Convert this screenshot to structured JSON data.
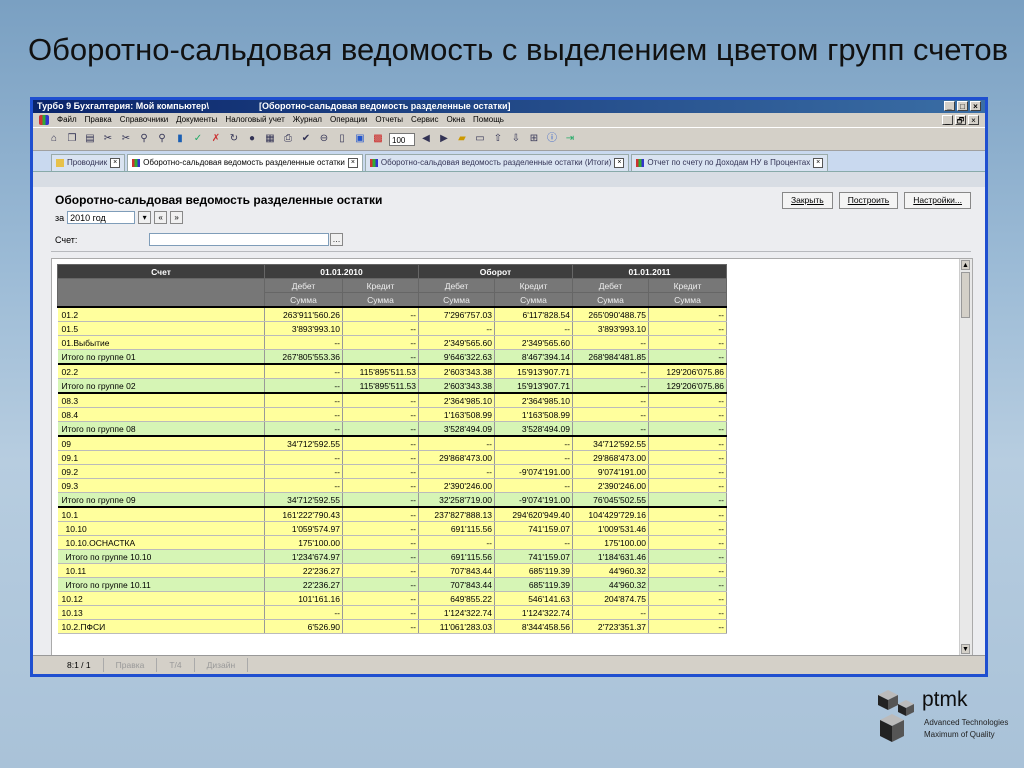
{
  "slide": {
    "title": "Оборотно-сальдовая ведомость с выделением цветом групп счетов"
  },
  "window": {
    "title_app": "Турбо 9 Бухгалтерия: Мой компьютер\\",
    "title_doc": "[Оборотно-сальдовая ведомость разделенные остатки]",
    "controls": [
      "_",
      "□",
      "×"
    ],
    "doc_controls": [
      "_",
      "🗗",
      "×"
    ]
  },
  "menu": [
    "Файл",
    "Правка",
    "Справочники",
    "Документы",
    "Налоговый учет",
    "Журнал",
    "Операции",
    "Отчеты",
    "Сервис",
    "Окна",
    "Помощь"
  ],
  "toolbar": {
    "zoom": "100"
  },
  "tabs": [
    {
      "label": "Проводник",
      "active": false
    },
    {
      "label": "Оборотно-сальдовая ведомость разделенные остатки",
      "active": true
    },
    {
      "label": "Оборотно-сальдовая ведомость разделенные остатки (Итоги)",
      "active": false
    },
    {
      "label": "Отчет по счету по Доходам НУ в Процентах",
      "active": false
    }
  ],
  "form": {
    "title": "Оборотно-сальдовая ведомость разделенные остатки",
    "buttons": {
      "close": "Закрыть",
      "build": "Построить",
      "settings": "Настройки..."
    },
    "period_label": "за",
    "period_value": "2010 год",
    "account_label": "Счет:",
    "account_value": ""
  },
  "table": {
    "group_headers": [
      "Счет",
      "01.01.2010",
      "Оборот",
      "01.01.2011"
    ],
    "sub_headers": [
      "Дебет",
      "Кредит",
      "Дебет",
      "Кредит",
      "Дебет",
      "Кредит"
    ],
    "sum_label": "Сумма",
    "rows": [
      {
        "name": "01.2",
        "style": "y",
        "bold": true,
        "indent": 0,
        "v": [
          "263'911'560.26",
          "--",
          "7'296'757.03",
          "6'117'828.54",
          "265'090'488.75",
          "--"
        ]
      },
      {
        "name": "01.5",
        "style": "y",
        "bold": false,
        "indent": 0,
        "v": [
          "3'893'993.10",
          "--",
          "--",
          "--",
          "3'893'993.10",
          "--"
        ]
      },
      {
        "name": "01.Выбытие",
        "style": "y",
        "bold": false,
        "indent": 0,
        "v": [
          "--",
          "--",
          "2'349'565.60",
          "2'349'565.60",
          "--",
          "--"
        ]
      },
      {
        "name": "Итого по группе 01",
        "style": "g",
        "bold": false,
        "indent": 0,
        "v": [
          "267'805'553.36",
          "--",
          "9'646'322.63",
          "8'467'394.14",
          "268'984'481.85",
          "--"
        ]
      },
      {
        "name": "02.2",
        "style": "y",
        "bold": true,
        "indent": 0,
        "v": [
          "--",
          "115'895'511.53",
          "2'603'343.38",
          "15'913'907.71",
          "--",
          "129'206'075.86"
        ]
      },
      {
        "name": "Итого по группе 02",
        "style": "g",
        "bold": false,
        "indent": 0,
        "v": [
          "--",
          "115'895'511.53",
          "2'603'343.38",
          "15'913'907.71",
          "--",
          "129'206'075.86"
        ]
      },
      {
        "name": "08.3",
        "style": "y",
        "bold": true,
        "indent": 0,
        "v": [
          "--",
          "--",
          "2'364'985.10",
          "2'364'985.10",
          "--",
          "--"
        ]
      },
      {
        "name": "08.4",
        "style": "y",
        "bold": false,
        "indent": 0,
        "v": [
          "--",
          "--",
          "1'163'508.99",
          "1'163'508.99",
          "--",
          "--"
        ]
      },
      {
        "name": "Итого по группе 08",
        "style": "g",
        "bold": false,
        "indent": 0,
        "v": [
          "--",
          "--",
          "3'528'494.09",
          "3'528'494.09",
          "--",
          "--"
        ]
      },
      {
        "name": "09",
        "style": "y",
        "bold": true,
        "indent": 0,
        "v": [
          "34'712'592.55",
          "--",
          "--",
          "--",
          "34'712'592.55",
          "--"
        ]
      },
      {
        "name": "09.1",
        "style": "y",
        "bold": false,
        "indent": 0,
        "v": [
          "--",
          "--",
          "29'868'473.00",
          "--",
          "29'868'473.00",
          "--"
        ]
      },
      {
        "name": "09.2",
        "style": "y",
        "bold": false,
        "indent": 0,
        "v": [
          "--",
          "--",
          "--",
          "-9'074'191.00",
          "9'074'191.00",
          "--"
        ]
      },
      {
        "name": "09.3",
        "style": "y",
        "bold": false,
        "indent": 0,
        "v": [
          "--",
          "--",
          "2'390'246.00",
          "--",
          "2'390'246.00",
          "--"
        ]
      },
      {
        "name": "Итого по группе 09",
        "style": "g",
        "bold": false,
        "indent": 0,
        "v": [
          "34'712'592.55",
          "--",
          "32'258'719.00",
          "-9'074'191.00",
          "76'045'502.55",
          "--"
        ]
      },
      {
        "name": "10.1",
        "style": "y",
        "bold": true,
        "indent": 0,
        "v": [
          "161'222'790.43",
          "--",
          "237'827'888.13",
          "294'620'949.40",
          "104'429'729.16",
          "--"
        ]
      },
      {
        "name": "10.10",
        "style": "y",
        "bold": false,
        "indent": 1,
        "v": [
          "1'059'574.97",
          "--",
          "691'115.56",
          "741'159.07",
          "1'009'531.46",
          "--"
        ]
      },
      {
        "name": "10.10.ОСНАСТКА",
        "style": "y",
        "bold": false,
        "indent": 1,
        "v": [
          "175'100.00",
          "--",
          "--",
          "--",
          "175'100.00",
          "--"
        ]
      },
      {
        "name": "Итого по группе 10.10",
        "style": "g",
        "bold": false,
        "indent": 1,
        "v": [
          "1'234'674.97",
          "--",
          "691'115.56",
          "741'159.07",
          "1'184'631.46",
          "--"
        ]
      },
      {
        "name": "10.11",
        "style": "y",
        "bold": false,
        "indent": 1,
        "v": [
          "22'236.27",
          "--",
          "707'843.44",
          "685'119.39",
          "44'960.32",
          "--"
        ]
      },
      {
        "name": "Итого по группе 10.11",
        "style": "g",
        "bold": false,
        "indent": 1,
        "v": [
          "22'236.27",
          "--",
          "707'843.44",
          "685'119.39",
          "44'960.32",
          "--"
        ]
      },
      {
        "name": "10.12",
        "style": "y",
        "bold": false,
        "indent": 0,
        "v": [
          "101'161.16",
          "--",
          "649'855.22",
          "546'141.63",
          "204'874.75",
          "--"
        ]
      },
      {
        "name": "10.13",
        "style": "y",
        "bold": false,
        "indent": 0,
        "v": [
          "--",
          "--",
          "1'124'322.74",
          "1'124'322.74",
          "--",
          "--"
        ]
      },
      {
        "name": "10.2.ПФСИ",
        "style": "y",
        "bold": false,
        "indent": 0,
        "v": [
          "6'526.90",
          "--",
          "11'061'283.03",
          "8'344'458.56",
          "2'723'351.37",
          "--"
        ]
      }
    ]
  },
  "status": {
    "pos": "8:1 / 1",
    "edit": "Правка",
    "page": "Т/4",
    "design": "Дизайн"
  },
  "logo": {
    "brand": "ptmk",
    "line1": "Advanced Technologies",
    "line2": "Maximum of Quality"
  },
  "colors": {
    "window_border": "#1f4fd0",
    "row_yellow": "#ffff9d",
    "row_green": "#d6f5b5",
    "header": "#3e3e3e"
  }
}
